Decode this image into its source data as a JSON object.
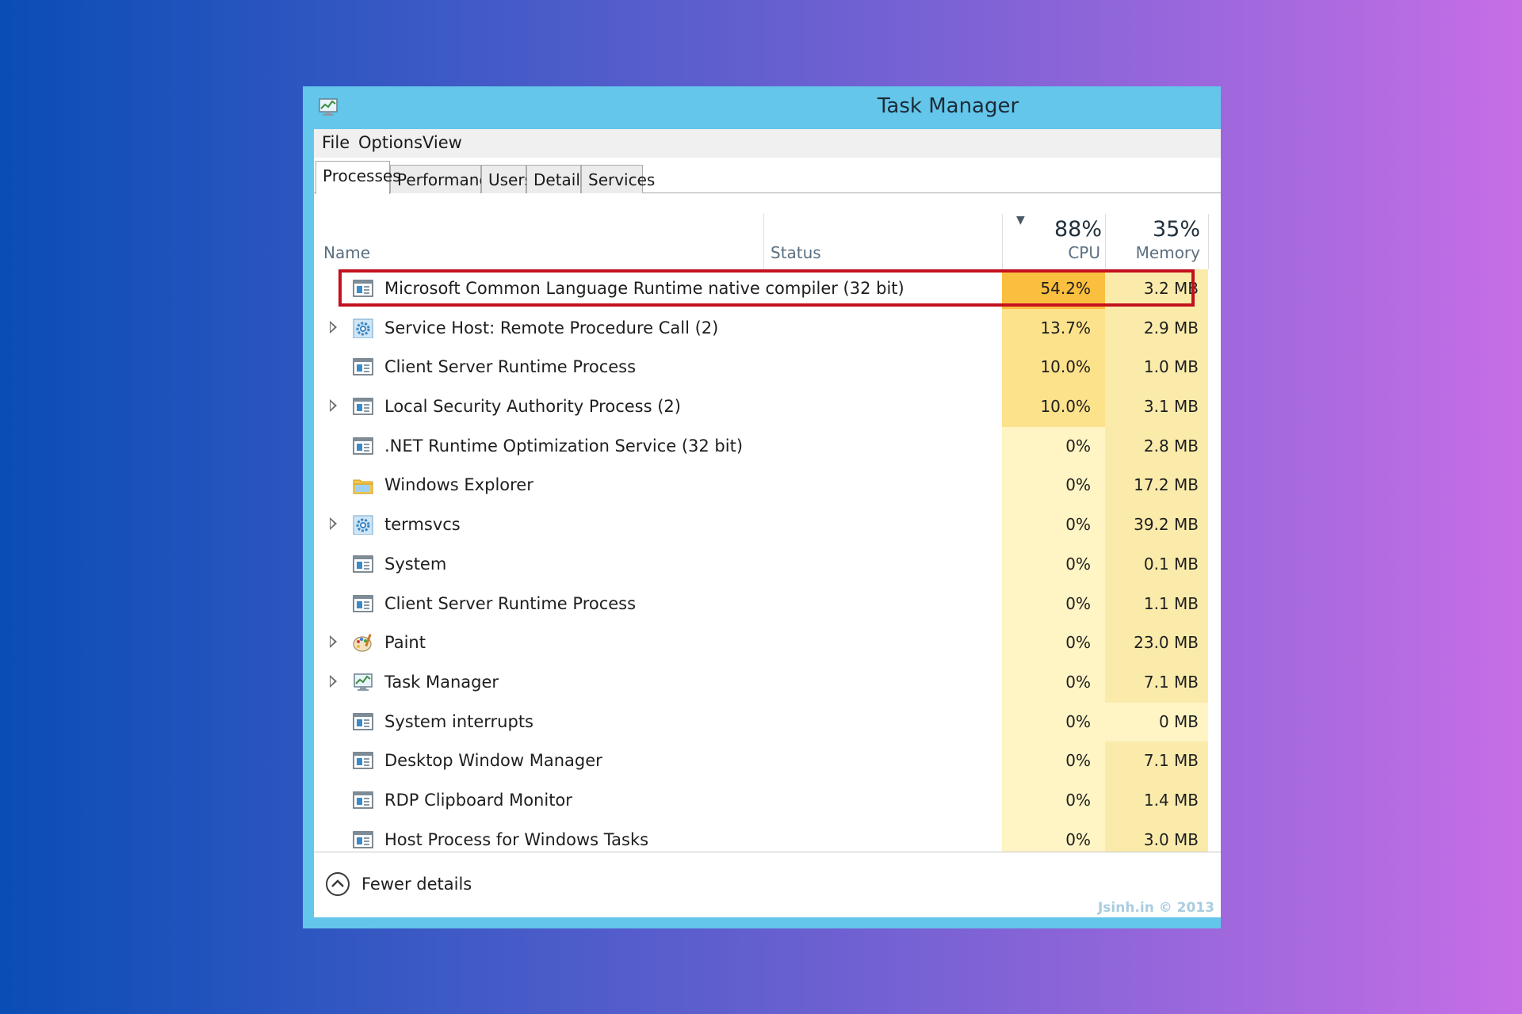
{
  "window": {
    "title": "Task Manager"
  },
  "menu": [
    "File",
    "Options",
    "View"
  ],
  "tabs": [
    "Processes",
    "Performance",
    "Users",
    "Details",
    "Services"
  ],
  "active_tab": "Processes",
  "columns": {
    "name": "Name",
    "status": "Status",
    "cpu_total": "88%",
    "cpu_label": "CPU",
    "memory_total": "35%",
    "memory_label": "Memory"
  },
  "processes": [
    {
      "name": "Microsoft Common Language Runtime native compiler (32 bit)",
      "cpu": "54.2%",
      "memory": "3.2 MB",
      "expandable": false,
      "icon": "app-window-icon",
      "highlighted": true
    },
    {
      "name": "Service Host: Remote Procedure Call (2)",
      "cpu": "13.7%",
      "memory": "2.9 MB",
      "expandable": true,
      "icon": "gear-icon"
    },
    {
      "name": "Client Server Runtime Process",
      "cpu": "10.0%",
      "memory": "1.0 MB",
      "expandable": false,
      "icon": "app-window-icon"
    },
    {
      "name": "Local Security Authority Process (2)",
      "cpu": "10.0%",
      "memory": "3.1 MB",
      "expandable": true,
      "icon": "app-window-icon"
    },
    {
      "name": ".NET Runtime Optimization Service (32 bit)",
      "cpu": "0%",
      "memory": "2.8 MB",
      "expandable": false,
      "icon": "app-window-icon"
    },
    {
      "name": "Windows Explorer",
      "cpu": "0%",
      "memory": "17.2 MB",
      "expandable": false,
      "icon": "folder-icon"
    },
    {
      "name": "termsvcs",
      "cpu": "0%",
      "memory": "39.2 MB",
      "expandable": true,
      "icon": "gear-icon"
    },
    {
      "name": "System",
      "cpu": "0%",
      "memory": "0.1 MB",
      "expandable": false,
      "icon": "app-window-icon"
    },
    {
      "name": "Client Server Runtime Process",
      "cpu": "0%",
      "memory": "1.1 MB",
      "expandable": false,
      "icon": "app-window-icon"
    },
    {
      "name": "Paint",
      "cpu": "0%",
      "memory": "23.0 MB",
      "expandable": true,
      "icon": "paint-palette-icon"
    },
    {
      "name": "Task Manager",
      "cpu": "0%",
      "memory": "7.1 MB",
      "expandable": true,
      "icon": "task-manager-icon"
    },
    {
      "name": "System interrupts",
      "cpu": "0%",
      "memory": "0 MB",
      "expandable": false,
      "icon": "app-window-icon"
    },
    {
      "name": "Desktop Window Manager",
      "cpu": "0%",
      "memory": "7.1 MB",
      "expandable": false,
      "icon": "app-window-icon"
    },
    {
      "name": "RDP Clipboard Monitor",
      "cpu": "0%",
      "memory": "1.4 MB",
      "expandable": false,
      "icon": "app-window-icon"
    },
    {
      "name": "Host Process for Windows Tasks",
      "cpu": "0%",
      "memory": "3.0 MB",
      "expandable": false,
      "icon": "app-window-icon"
    }
  ],
  "footer": {
    "fewer_details": "Fewer details"
  },
  "watermark": "Jsinh.in © 2013",
  "colors": {
    "cpu_heat_high": "#fbbf3f",
    "cpu_heat_mid": "#fde28c",
    "cpu_heat_low": "#fff4c4",
    "mem_heat": "#faebab",
    "mem_heat_zero": "#fff4c4",
    "highlight_border": "#c2111e",
    "titlebar": "#63c6ea"
  }
}
